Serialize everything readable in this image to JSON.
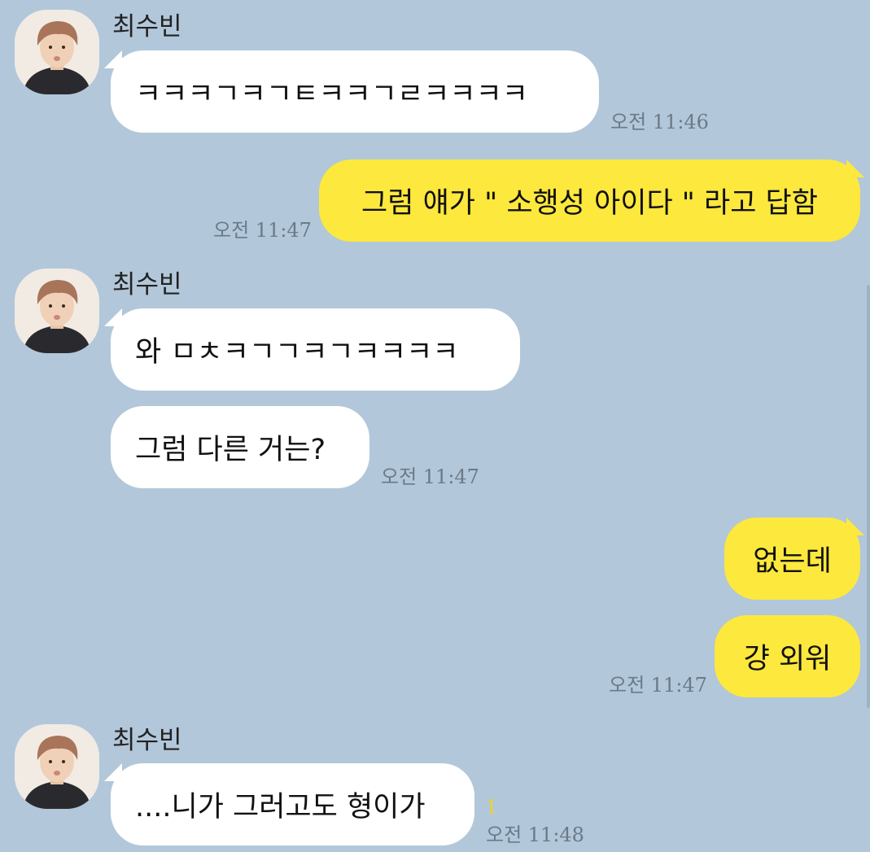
{
  "colors": {
    "background": "#b2c7da",
    "incoming_bubble": "#ffffff",
    "outgoing_bubble": "#fde83d",
    "timestamp": "#6b7a87",
    "unread_count": "#f2d31a"
  },
  "sender": {
    "name": "최수빈",
    "avatar_icon": "profile-photo"
  },
  "messages": [
    {
      "from": "other",
      "text": "ㅋㅋㅋㄱㅋㄱㅌㅋㅋㄱㄹㅋㅋㅋㅋ",
      "time": "오전 11:46"
    },
    {
      "from": "me",
      "text": "그럼 얘가 \" 소행성 아이다 \" 라고 답함",
      "time": "오전 11:47"
    },
    {
      "from": "other",
      "text": "와 ㅁㅊㅋㄱㄱㅋㄱㅋㅋㅋㅋ"
    },
    {
      "from": "other",
      "text": "그럼 다른 거는?",
      "time": "오전 11:47"
    },
    {
      "from": "me",
      "text": "없는데"
    },
    {
      "from": "me",
      "text": "걍 외워",
      "time": "오전 11:47"
    },
    {
      "from": "other",
      "text": "....니가 그러고도 형이가",
      "time": "오전 11:48",
      "unread": "1"
    }
  ]
}
